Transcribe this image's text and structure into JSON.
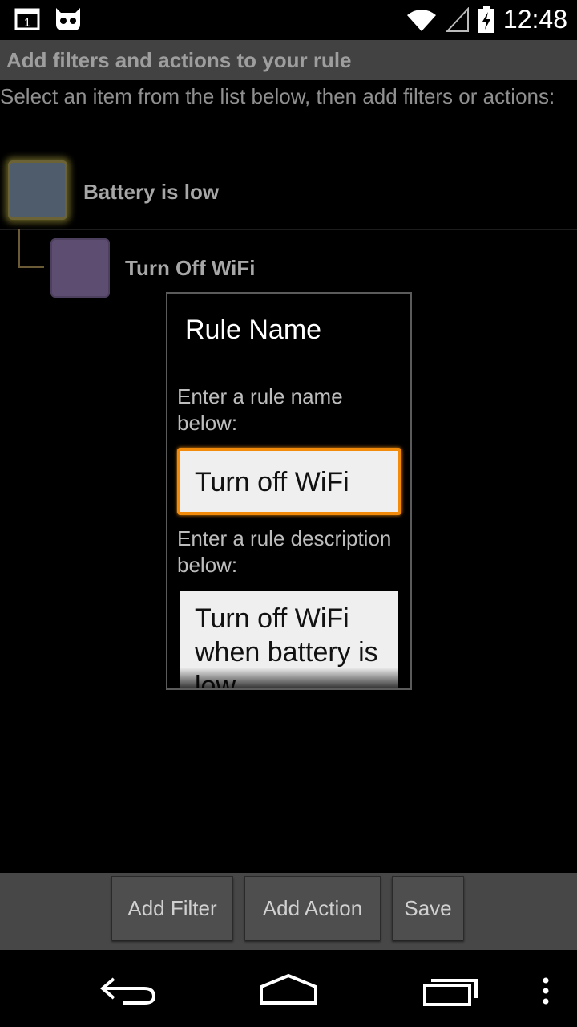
{
  "status_bar": {
    "time": "12:48",
    "notification_badge": "1",
    "icons": [
      "calendar-notification-icon",
      "cyanogen-icon",
      "wifi-icon",
      "signal-icon",
      "battery-charging-icon"
    ]
  },
  "title_bar": {
    "title": "Add filters and actions to your rule"
  },
  "instructions": "Select an item from the list below, then add filters or actions:",
  "rule_tree": {
    "filter": {
      "label": "Battery is low",
      "color": "#4e5c6b"
    },
    "action": {
      "label": "Turn Off WiFi",
      "color": "#5c4d71"
    }
  },
  "dialog": {
    "title": "Rule Name",
    "name_prompt": "Enter a rule name below:",
    "name_value": "Turn off WiFi",
    "description_prompt": "Enter a rule description below:",
    "description_value": "Turn off WiFi when battery is low",
    "focus_color": "#f28b0c"
  },
  "buttons": {
    "add_filter": "Add Filter",
    "add_action": "Add Action",
    "save": "Save"
  },
  "nav_bar": {
    "icons": [
      "back-icon",
      "home-icon",
      "recents-icon",
      "menu-icon"
    ]
  }
}
